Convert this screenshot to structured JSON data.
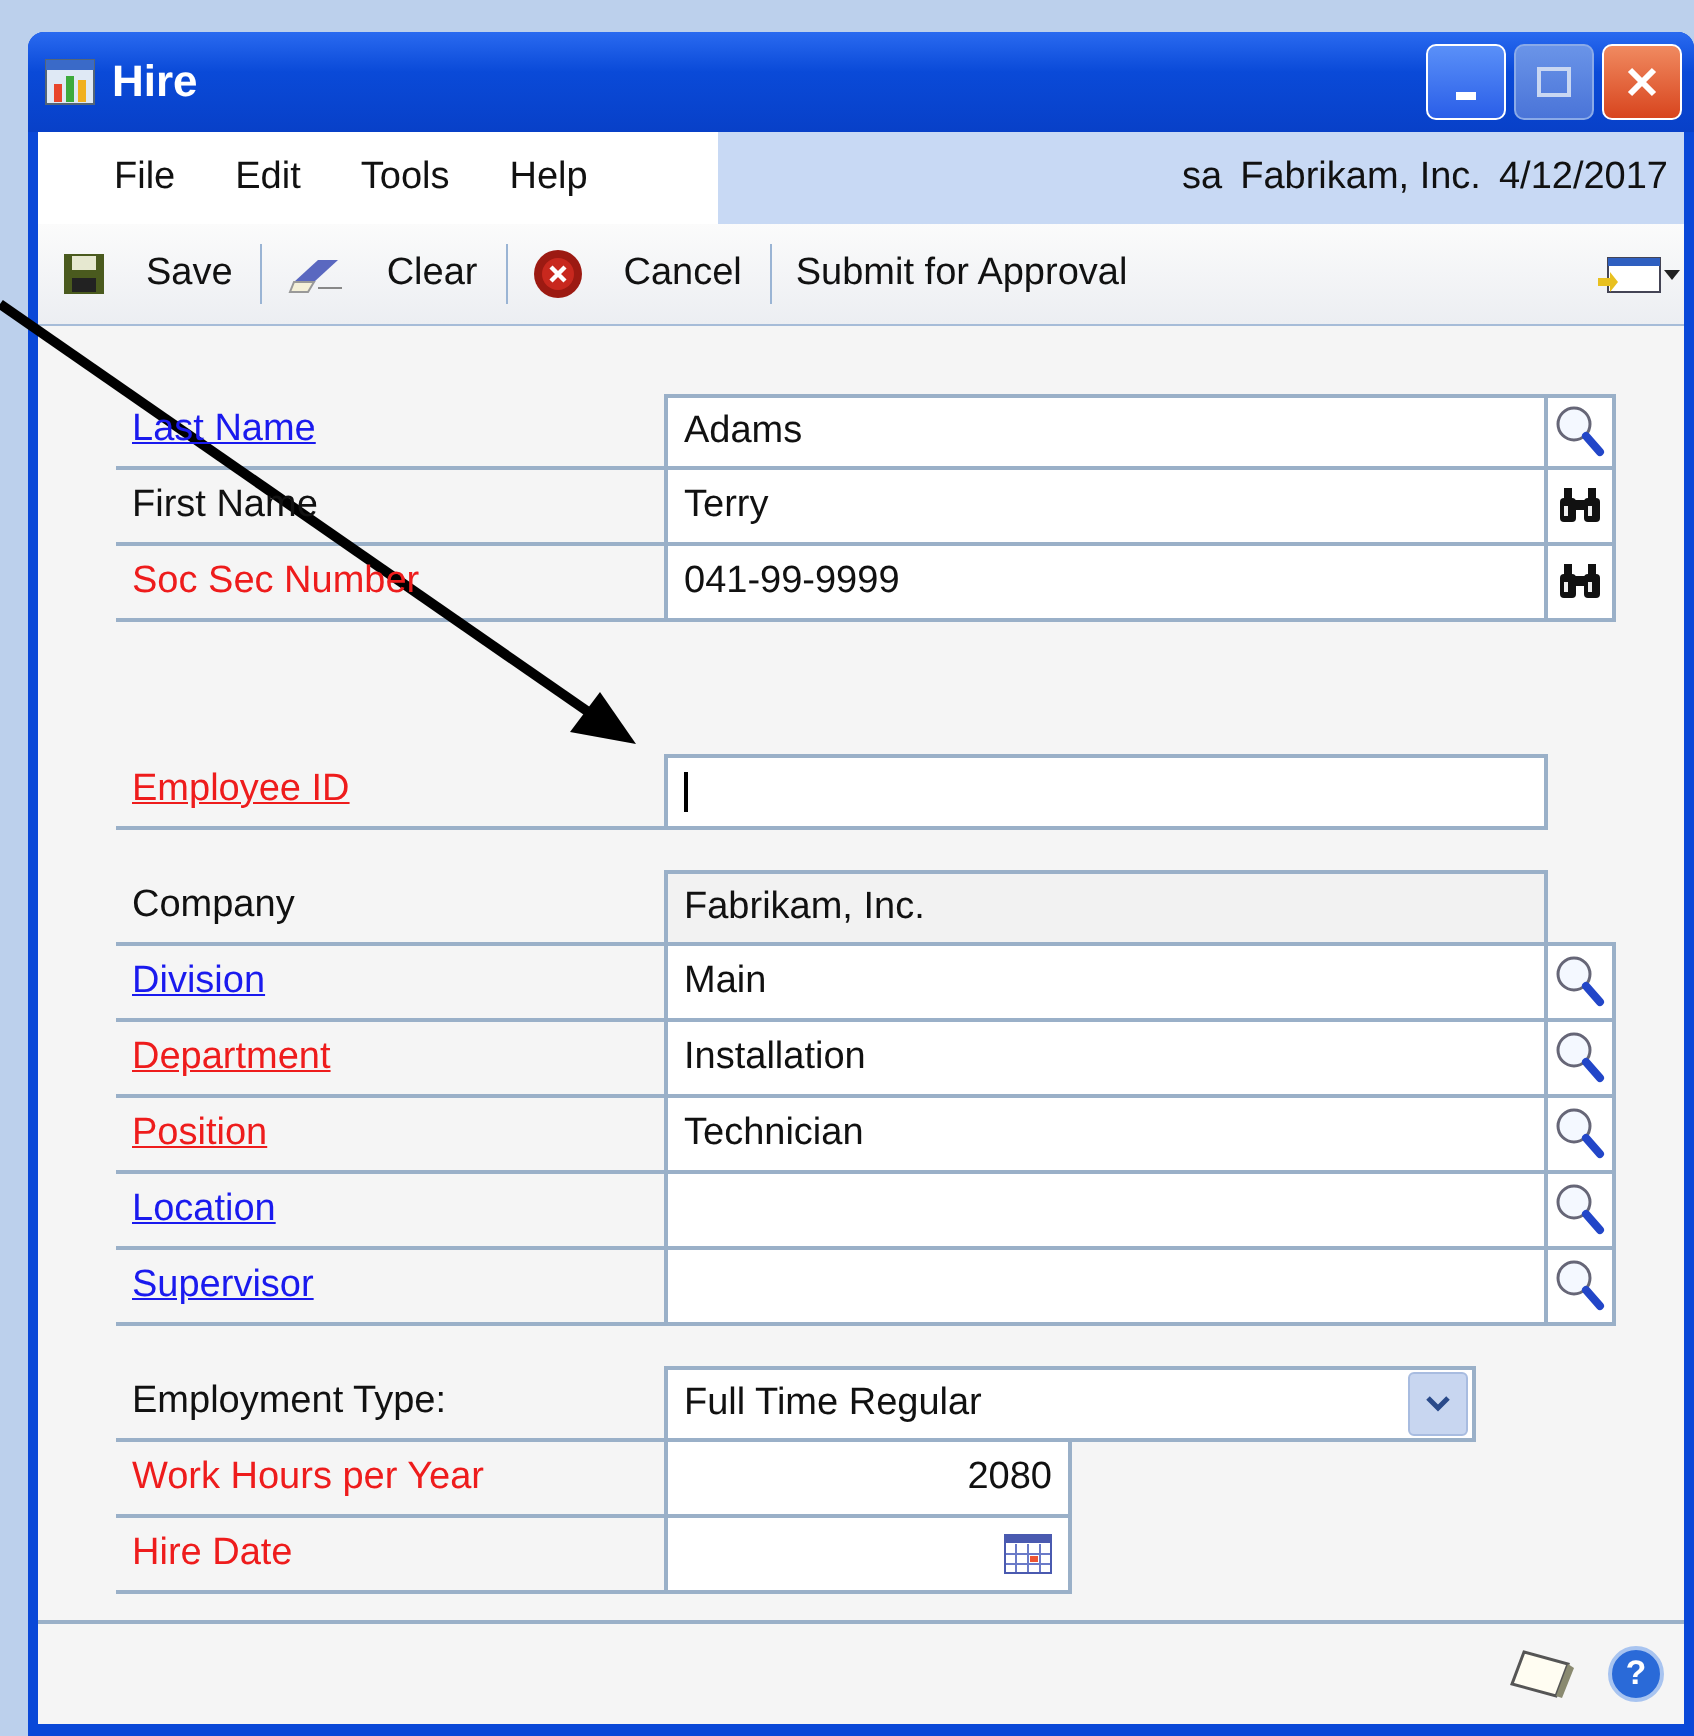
{
  "window": {
    "title": "Hire"
  },
  "menu": [
    "File",
    "Edit",
    "Tools",
    "Help"
  ],
  "session": {
    "user": "sa",
    "company": "Fabrikam, Inc.",
    "date": "4/12/2017"
  },
  "toolbar": [
    {
      "label": "Save",
      "kind": "save"
    },
    {
      "label": "Clear",
      "kind": "clear"
    },
    {
      "label": "Cancel",
      "kind": "cancel"
    },
    {
      "label": "Submit for Approval",
      "kind": "plain"
    }
  ],
  "sections": [
    {
      "rows": [
        {
          "label": {
            "text": "Last Name",
            "kind": "link"
          },
          "value": "Adams",
          "kind": "text",
          "button": {
            "kind": "magnifier"
          },
          "disabled": false
        },
        {
          "label": {
            "text": "First Name",
            "kind": "plain"
          },
          "value": "Terry",
          "kind": "text",
          "button": {
            "kind": "binoculars"
          },
          "disabled": false
        },
        {
          "label": {
            "text": "Soc Sec Number",
            "kind": "required"
          },
          "value": "041-99-9999",
          "kind": "text",
          "button": {
            "kind": "binoculars"
          },
          "disabled": false
        }
      ]
    },
    {
      "rows": [
        {
          "label": {
            "text": "Employee ID",
            "kind": "required-link"
          },
          "value": "",
          "kind": "text",
          "disabled": false,
          "focused": true
        }
      ]
    },
    {
      "rows": [
        {
          "label": {
            "text": "Company",
            "kind": "plain"
          },
          "value": "Fabrikam, Inc.",
          "kind": "text",
          "disabled": true
        },
        {
          "label": {
            "text": "Division",
            "kind": "link"
          },
          "value": "Main",
          "kind": "text",
          "button": {
            "kind": "magnifier"
          },
          "disabled": false
        },
        {
          "label": {
            "text": "Department",
            "kind": "required-link"
          },
          "value": "Installation",
          "kind": "text",
          "button": {
            "kind": "magnifier"
          },
          "disabled": false
        },
        {
          "label": {
            "text": "Position",
            "kind": "required-link"
          },
          "value": "Technician",
          "kind": "text",
          "button": {
            "kind": "magnifier"
          },
          "disabled": false
        },
        {
          "label": {
            "text": "Location",
            "kind": "link"
          },
          "value": "",
          "kind": "text",
          "button": {
            "kind": "magnifier"
          },
          "disabled": false
        },
        {
          "label": {
            "text": "Supervisor",
            "kind": "link"
          },
          "value": "",
          "kind": "text",
          "button": {
            "kind": "magnifier"
          },
          "disabled": false
        }
      ]
    },
    {
      "rows": [
        {
          "label": {
            "text": "Employment Type:",
            "kind": "plain"
          },
          "value": "Full Time Regular",
          "kind": "dropdown",
          "disabled": false
        },
        {
          "label": {
            "text": "Work Hours per Year",
            "kind": "required"
          },
          "value": "2080",
          "kind": "number",
          "disabled": false
        },
        {
          "label": {
            "text": "Hire Date",
            "kind": "required"
          },
          "value": "",
          "kind": "date",
          "disabled": false
        }
      ]
    }
  ],
  "footer": {
    "help": "?"
  }
}
